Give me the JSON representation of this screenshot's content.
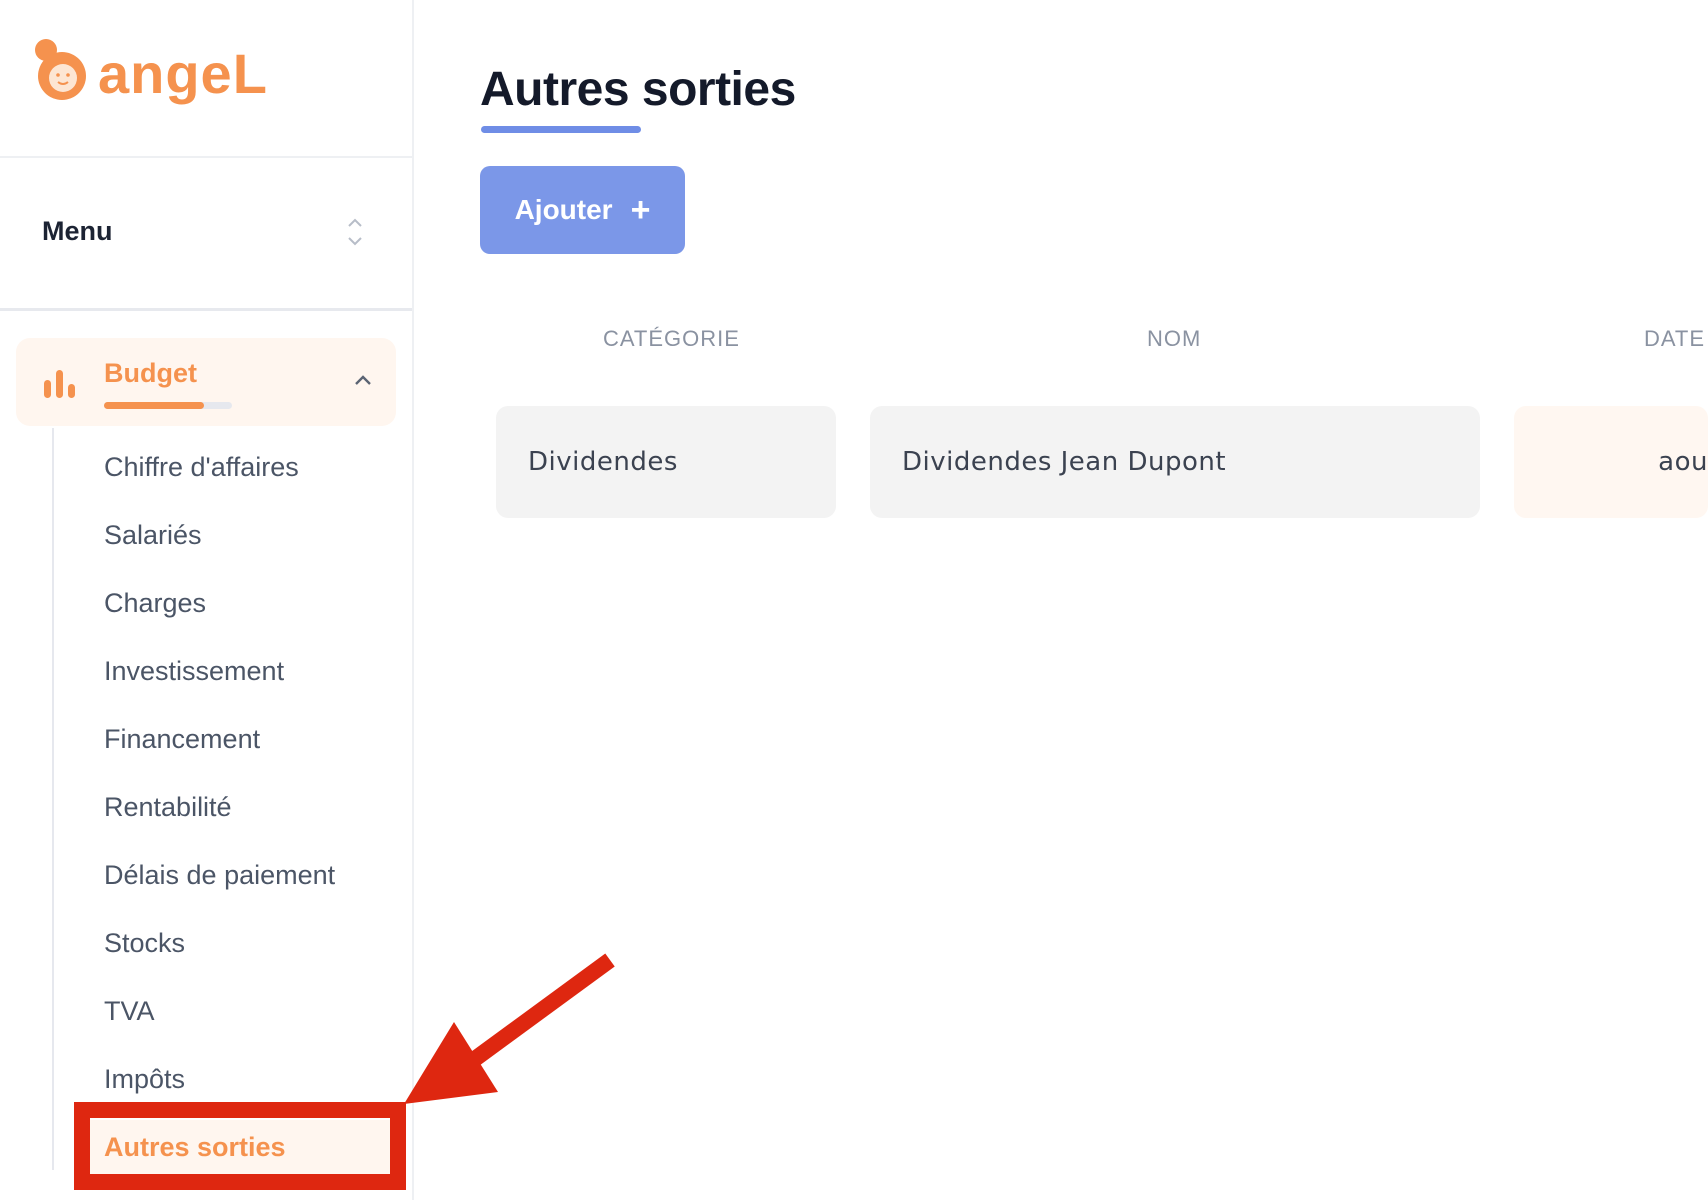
{
  "brand": {
    "logo_text": "angeL",
    "accent_color": "#f5924e",
    "primary_color": "#7b97e8"
  },
  "sidebar": {
    "menu_label": "Menu",
    "section": {
      "label": "Budget",
      "icon": "bar-chart-icon",
      "expanded": true,
      "progress": 0.78
    },
    "items": [
      {
        "label": "Chiffre d'affaires",
        "active": false
      },
      {
        "label": "Salariés",
        "active": false
      },
      {
        "label": "Charges",
        "active": false
      },
      {
        "label": "Investissement",
        "active": false
      },
      {
        "label": "Financement",
        "active": false
      },
      {
        "label": "Rentabilité",
        "active": false
      },
      {
        "label": "Délais de paiement",
        "active": false
      },
      {
        "label": "Stocks",
        "active": false
      },
      {
        "label": "TVA",
        "active": false
      },
      {
        "label": "Impôts",
        "active": false
      },
      {
        "label": "Autres sorties",
        "active": true
      }
    ]
  },
  "main": {
    "title": "Autres sorties",
    "add_button": {
      "label": "Ajouter",
      "icon": "plus-icon"
    },
    "table": {
      "headers": [
        "CATÉGORIE",
        "NOM",
        "DATE"
      ],
      "rows": [
        {
          "category": "Dividendes",
          "name": "Dividendes Jean Dupont",
          "date": "aou"
        }
      ]
    }
  },
  "annotation": {
    "color": "#de2710",
    "target": "Autres sorties"
  }
}
